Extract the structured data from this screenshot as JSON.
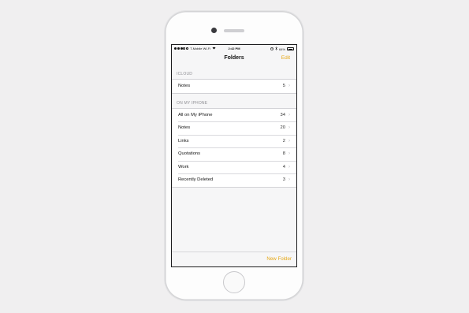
{
  "status_bar": {
    "carrier": "T-Mobile Wi-Fi",
    "time": "2:42 PM",
    "battery": "64%"
  },
  "nav": {
    "title": "Folders",
    "edit_label": "Edit"
  },
  "icloud": {
    "header": "ICLOUD",
    "rows": [
      {
        "label": "Notes",
        "count": "5"
      }
    ]
  },
  "on_my_iphone": {
    "header": "ON MY IPHONE",
    "rows": [
      {
        "label": "All on My iPhone",
        "count": "34"
      },
      {
        "label": "Notes",
        "count": "20"
      },
      {
        "label": "Links",
        "count": "2"
      },
      {
        "label": "Quotations",
        "count": "8"
      },
      {
        "label": "Work",
        "count": "4"
      },
      {
        "label": "Recently Deleted",
        "count": "3"
      }
    ]
  },
  "toolbar": {
    "new_folder_label": "New Folder"
  },
  "colors": {
    "accent": "#e6a817",
    "background": "#f0eff0"
  }
}
